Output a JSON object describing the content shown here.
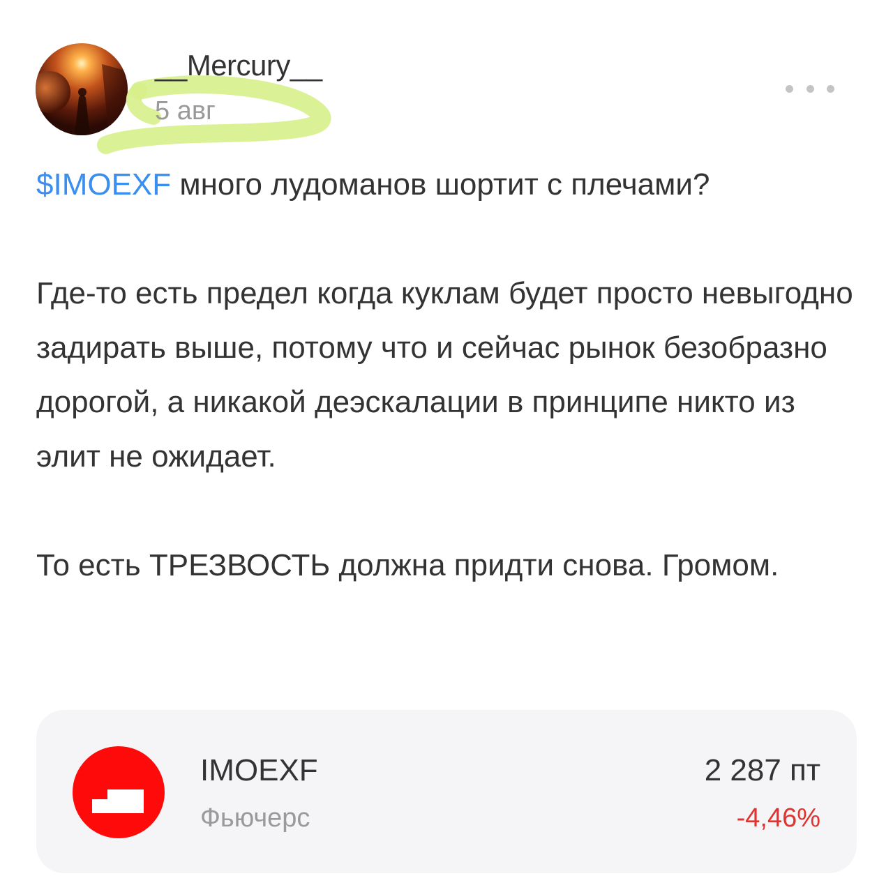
{
  "post": {
    "author": "__Mercury__",
    "date": "5 авг",
    "more_icon": "more-horizontal-icon",
    "ticker_tag": "$IMOEXF",
    "line1_rest": " много лудоманов шортит с плечами?",
    "paragraph2": "Где-то есть предел когда куклам будет просто невыгодно задирать выше, потому что и сейчас рынок безобразно дорогой, а никакой деэскалации в принципе никто из элит не ожидает.",
    "paragraph3": "То есть ТРЕЗВОСТЬ должна придти снова. Громом."
  },
  "instrument": {
    "ticker": "IMOEXF",
    "type": "Фьючерс",
    "price": "2 287 пт",
    "change": "-4,46%",
    "logo_icon": "moex-logo-icon"
  },
  "colors": {
    "link": "#3a8ef0",
    "negative": "#e0322f",
    "logo_red": "#ff0a0a",
    "highlight": "#d6f08a"
  }
}
